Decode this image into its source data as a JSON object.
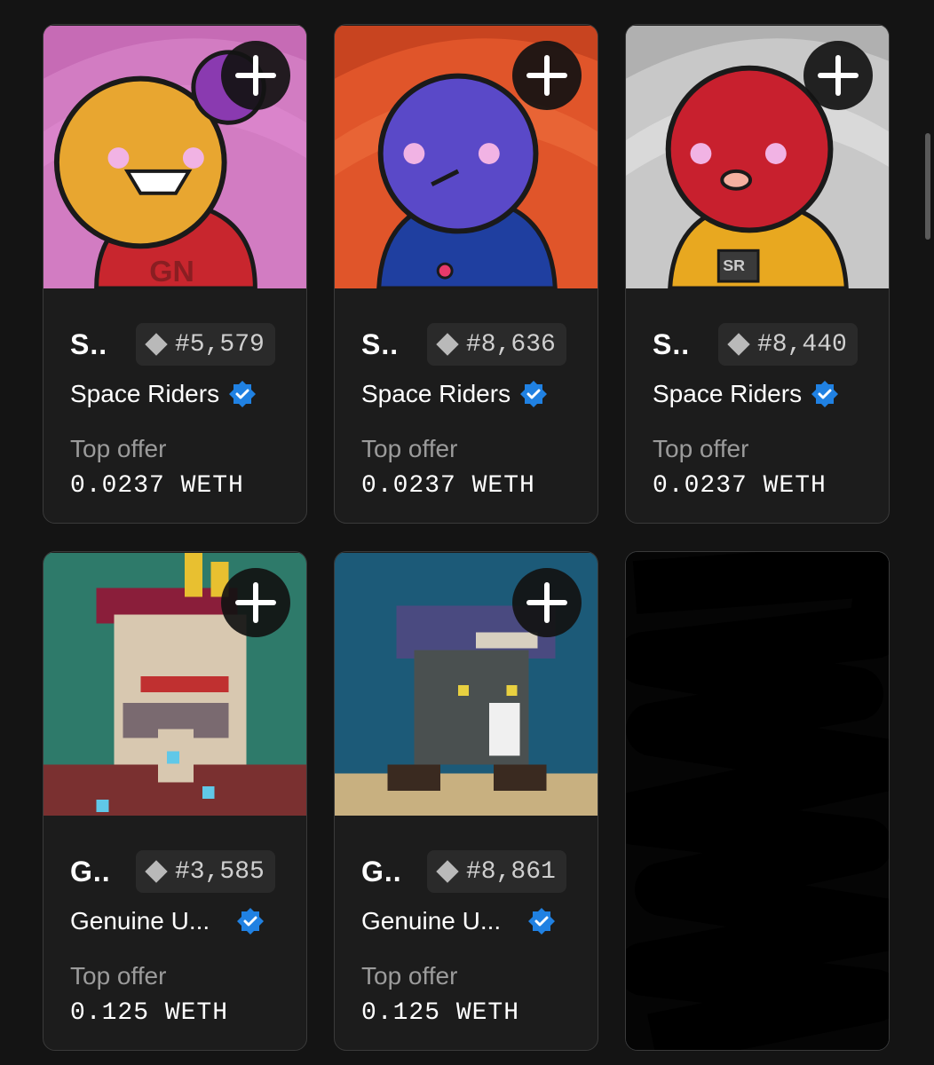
{
  "cards": [
    {
      "short_name": "S..",
      "token_id": "#5,579",
      "collection": "Space Riders",
      "offer_label": "Top offer",
      "offer_value": "0.0237 WETH"
    },
    {
      "short_name": "S..",
      "token_id": "#8,636",
      "collection": "Space Riders",
      "offer_label": "Top offer",
      "offer_value": "0.0237 WETH"
    },
    {
      "short_name": "S..",
      "token_id": "#8,440",
      "collection": "Space Riders",
      "offer_label": "Top offer",
      "offer_value": "0.0237 WETH"
    },
    {
      "short_name": "G..",
      "token_id": "#3,585",
      "collection": "Genuine U...",
      "offer_label": "Top offer",
      "offer_value": "0.125 WETH"
    },
    {
      "short_name": "G..",
      "token_id": "#8,861",
      "collection": "Genuine U...",
      "offer_label": "Top offer",
      "offer_value": "0.125 WETH"
    }
  ],
  "icons": {
    "add": "plus-icon",
    "verified": "verified-badge-icon",
    "token": "diamond-icon"
  },
  "colors": {
    "background": "#141414",
    "card": "#1c1c1c",
    "verified": "#2081e2"
  }
}
